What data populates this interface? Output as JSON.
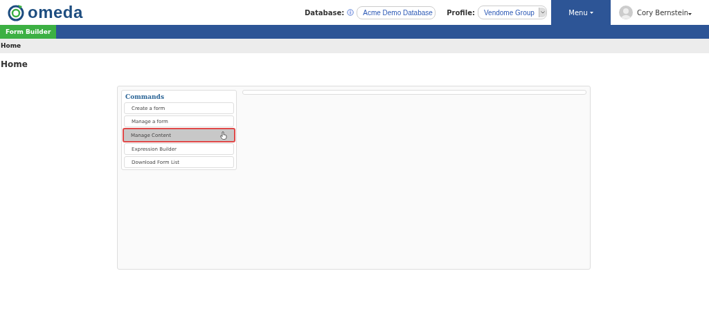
{
  "header": {
    "logo": "omeda",
    "database_label": "Database:",
    "database_value": "Acme Demo Database",
    "profile_label": "Profile:",
    "profile_value": "Vendome Group",
    "menu": "Menu",
    "user": "Cory Bernstein"
  },
  "nav": {
    "tabs": [
      {
        "label": "Form Builder",
        "selected": true
      }
    ]
  },
  "breadcrumb": "Home",
  "page_title": "Home",
  "commands": {
    "title": "Commands",
    "items": [
      {
        "label": "Create a form",
        "selected": false
      },
      {
        "label": "Manage a form",
        "selected": false
      },
      {
        "label": "Manage Content",
        "selected": true
      },
      {
        "label": "Expression Builder",
        "selected": false
      },
      {
        "label": "Download Form List",
        "selected": false
      }
    ]
  }
}
